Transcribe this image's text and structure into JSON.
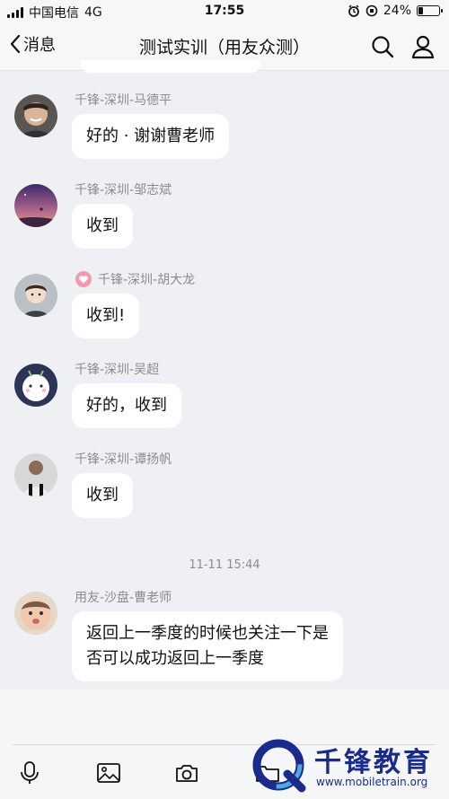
{
  "status": {
    "carrier": "中国电信",
    "network": "4G",
    "time": "17:55",
    "battery": "24%",
    "battery_level": 0.24
  },
  "nav": {
    "back_label": "消息",
    "title": "测试实训（用友众测）"
  },
  "messages": [
    {
      "sender": "千锋-深圳-马德平",
      "text": "好的 · 谢谢曹老师"
    },
    {
      "sender": "千锋-深圳-邹志斌",
      "text": "收到"
    },
    {
      "sender": "千锋-深圳-胡大龙",
      "text": "收到!"
    },
    {
      "sender": "千锋-深圳-吴超",
      "text": "好的，收到"
    },
    {
      "sender": "千锋-深圳-谭扬帆",
      "text": "收到"
    },
    {
      "sender": "用友-沙盘-曹老师",
      "text_line1": "返回上一季度的时候也关注一下是",
      "text_line2": "否可以成功返回上一季度"
    }
  ],
  "timestamp": "11-11 15:44",
  "watermark": {
    "title": "千锋教育",
    "url": "www.mobiletrain.org"
  },
  "colors": {
    "bubble": "#ffffff",
    "background": "#eef0f3",
    "badge": "#f49ab0",
    "watermark": "#1a2b8c"
  }
}
